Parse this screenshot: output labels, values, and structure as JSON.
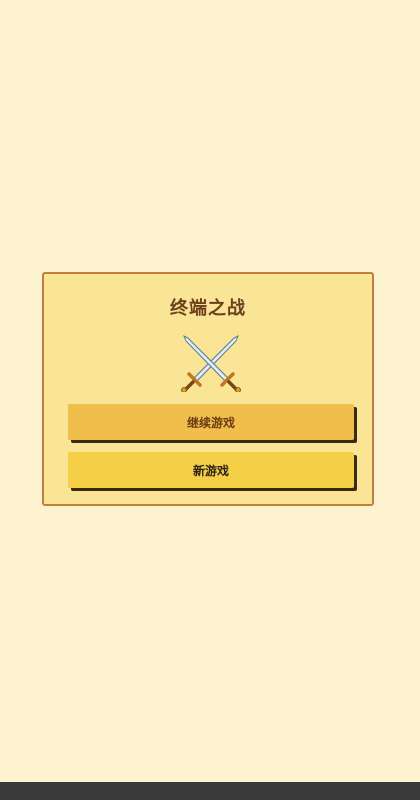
{
  "dialog": {
    "title": "终端之战",
    "icon": "crossed-swords-icon",
    "buttons": {
      "continue_label": "继续游戏",
      "new_game_label": "新游戏"
    }
  },
  "colors": {
    "background": "#fdf3cf",
    "panel": "#f9e595",
    "panel_border": "#c37d3e",
    "continue_button": "#f2be4b",
    "new_game_button": "#f5d047",
    "title_text": "#6b3f1c"
  }
}
